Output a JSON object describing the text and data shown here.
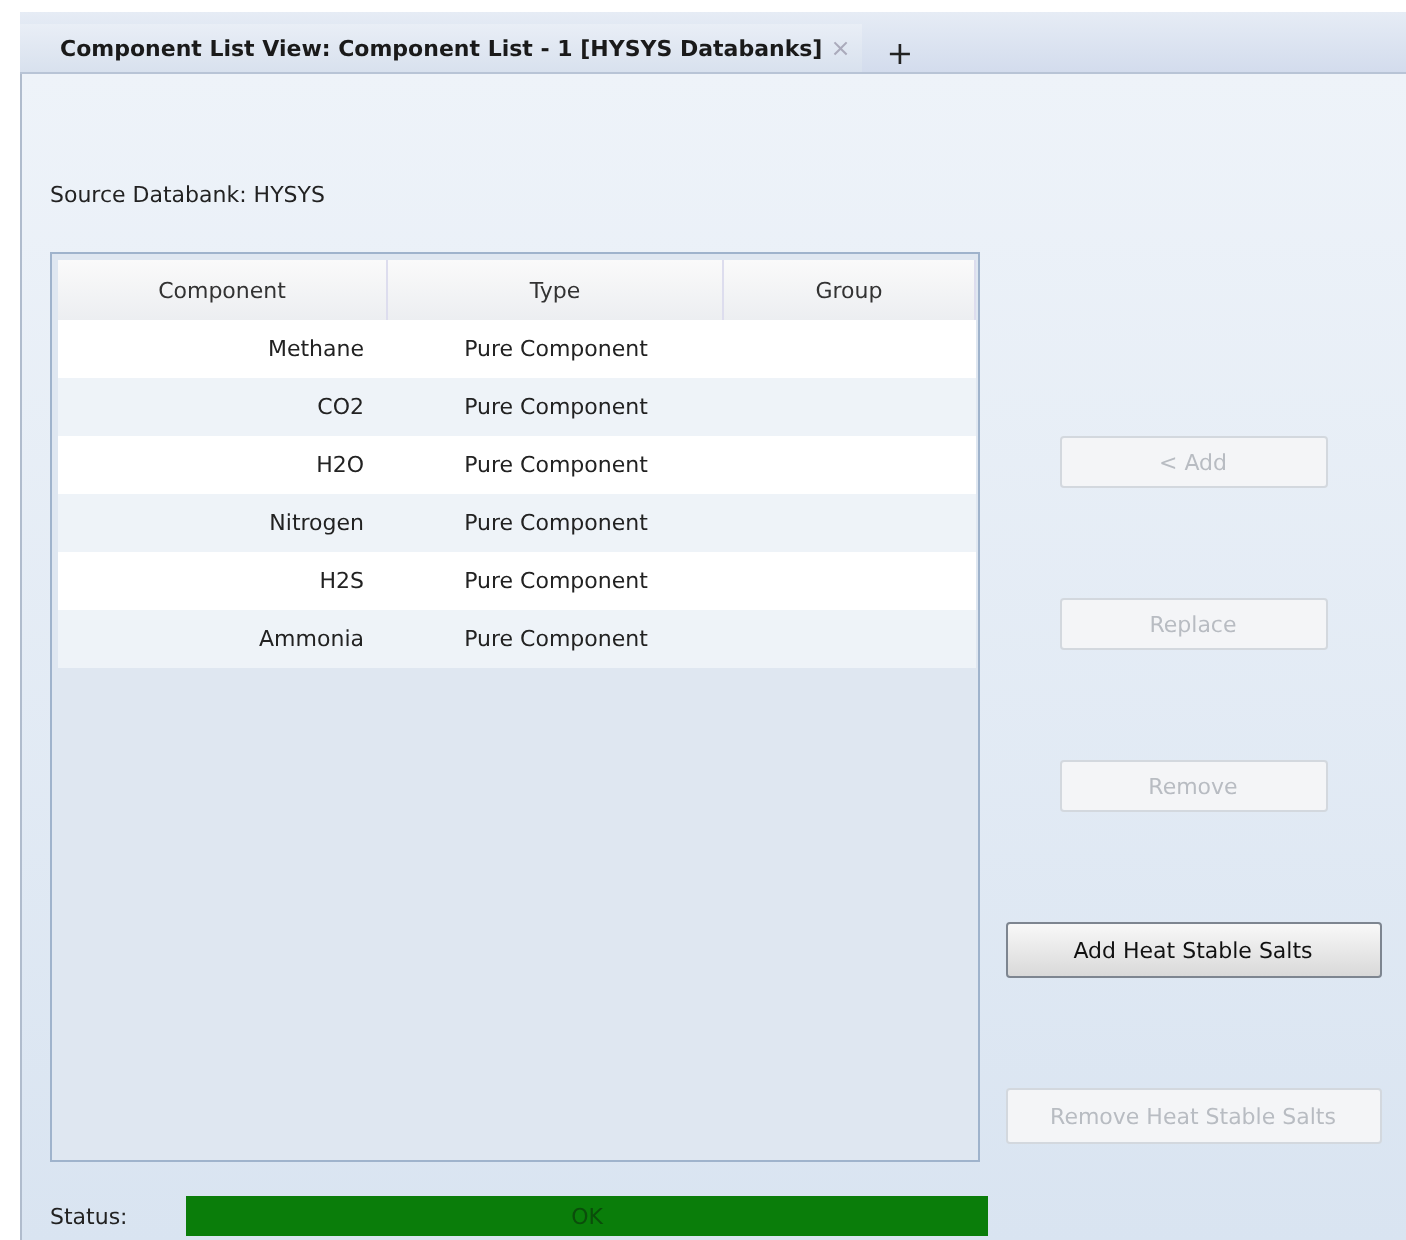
{
  "tab": {
    "title": "Component List View: Component List - 1 [HYSYS Databanks]",
    "close": "×",
    "add": "+"
  },
  "source_label": "Source Databank: HYSYS",
  "table": {
    "columns": [
      "Component",
      "Type",
      "Group"
    ],
    "rows": [
      {
        "component": "Methane",
        "type": "Pure Component",
        "group": ""
      },
      {
        "component": "CO2",
        "type": "Pure Component",
        "group": ""
      },
      {
        "component": "H2O",
        "type": "Pure Component",
        "group": ""
      },
      {
        "component": "Nitrogen",
        "type": "Pure Component",
        "group": ""
      },
      {
        "component": "H2S",
        "type": "Pure Component",
        "group": ""
      },
      {
        "component": "Ammonia",
        "type": "Pure Component",
        "group": ""
      }
    ]
  },
  "buttons": [
    {
      "label": "< Add",
      "disabled": true,
      "kind": "narrow"
    },
    {
      "label": "Replace",
      "disabled": true,
      "kind": "narrow"
    },
    {
      "label": "Remove",
      "disabled": true,
      "kind": "narrow"
    },
    {
      "label": "Add Heat Stable Salts",
      "disabled": false,
      "kind": "wide"
    },
    {
      "label": "Remove Heat Stable Salts",
      "disabled": true,
      "kind": "wide"
    }
  ],
  "status": {
    "label": "Status:",
    "value": "OK",
    "color": "#0a7d0a"
  }
}
